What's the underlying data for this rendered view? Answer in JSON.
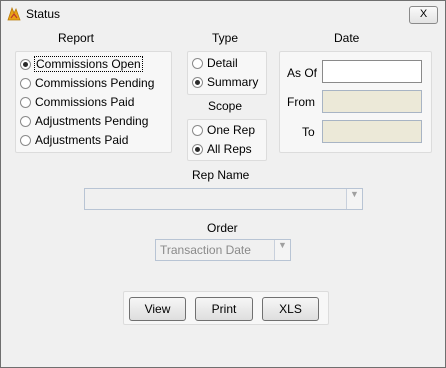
{
  "window": {
    "title": "Status",
    "close_label": "X"
  },
  "report": {
    "header": "Report",
    "options": [
      {
        "label": "Commissions Open",
        "selected": true
      },
      {
        "label": "Commissions Pending",
        "selected": false
      },
      {
        "label": "Commissions Paid",
        "selected": false
      },
      {
        "label": "Adjustments Pending",
        "selected": false
      },
      {
        "label": "Adjustments Paid",
        "selected": false
      }
    ]
  },
  "type": {
    "header": "Type",
    "options": [
      {
        "label": "Detail",
        "selected": false
      },
      {
        "label": "Summary",
        "selected": true
      }
    ]
  },
  "scope": {
    "header": "Scope",
    "options": [
      {
        "label": "One Rep",
        "selected": false
      },
      {
        "label": "All Reps",
        "selected": true
      }
    ]
  },
  "date": {
    "header": "Date",
    "as_of_label": "As Of",
    "as_of_value": "",
    "from_label": "From",
    "from_value": "",
    "to_label": "To",
    "to_value": ""
  },
  "rep_name": {
    "label": "Rep Name",
    "value": ""
  },
  "order": {
    "label": "Order",
    "value": "Transaction Date"
  },
  "buttons": {
    "view": "View",
    "print": "Print",
    "xls": "XLS"
  },
  "colors": {
    "window_bg": "#f0f0f0",
    "disabled_field": "#ece9d8",
    "title_icon": "#e8a317"
  }
}
